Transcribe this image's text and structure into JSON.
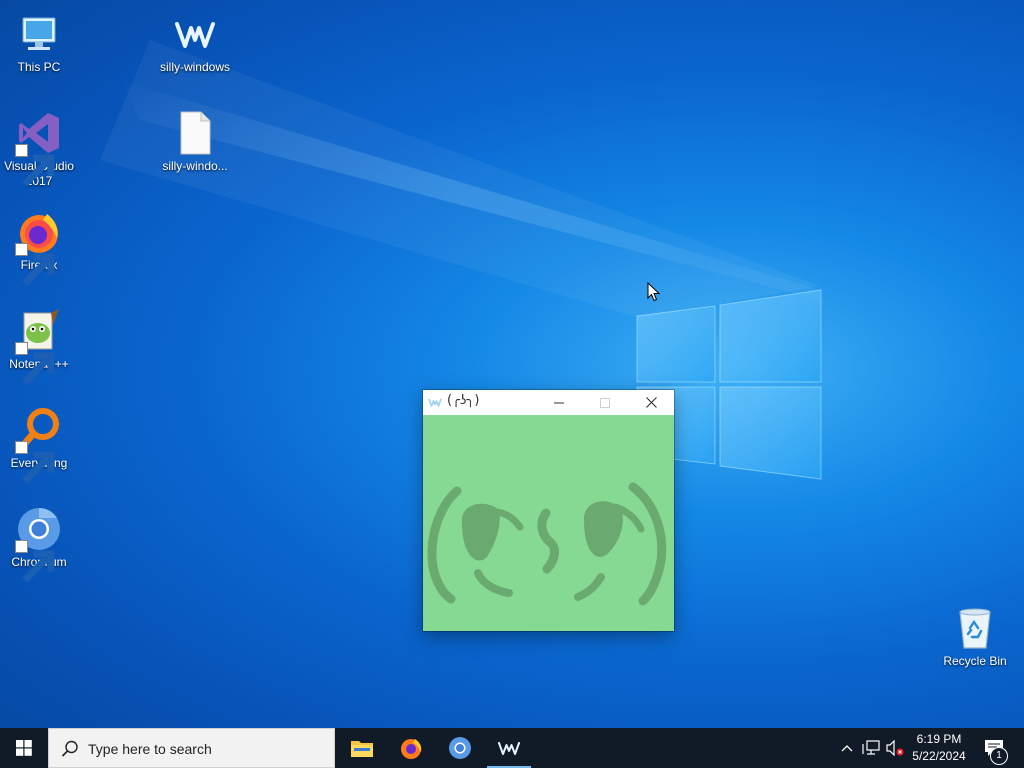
{
  "desktop": {
    "icons": [
      {
        "label": "This PC"
      },
      {
        "label": "silly-windows"
      },
      {
        "label": "Visual Studio 2017"
      },
      {
        "label": "silly-windo..."
      },
      {
        "label": "Firefox"
      },
      {
        "label": "Notepad++"
      },
      {
        "label": "Everything"
      },
      {
        "label": "Chromium"
      },
      {
        "label": "Recycle Bin"
      }
    ]
  },
  "window": {
    "title": "(╭ʖ╮)",
    "icon": "silly-windows-icon",
    "face_color": "#6aa96f",
    "background": "#86d993"
  },
  "taskbar": {
    "search_placeholder": "Type here to search",
    "apps": [
      "file-explorer-icon",
      "firefox-icon",
      "chromium-icon",
      "silly-windows-icon"
    ],
    "clock": {
      "time": "6:19 PM",
      "date": "5/22/2024"
    },
    "notification_count": "1"
  }
}
